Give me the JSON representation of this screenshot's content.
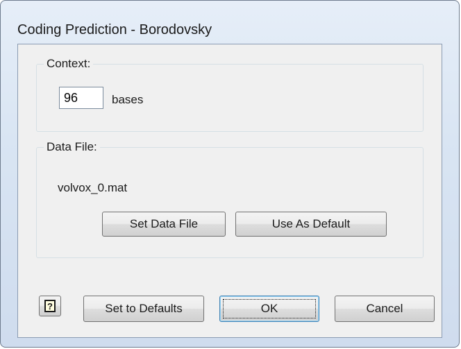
{
  "window": {
    "title": "Coding Prediction - Borodovsky"
  },
  "context": {
    "group_label": "Context:",
    "value": "96",
    "unit": "bases"
  },
  "data_file": {
    "group_label": "Data File:",
    "file_name": "volvox_0.mat",
    "set_button": "Set Data File",
    "default_button": "Use As Default"
  },
  "footer": {
    "help_icon": "question-mark-icon",
    "help_glyph": "?",
    "defaults_button": "Set to Defaults",
    "ok_button": "OK",
    "cancel_button": "Cancel"
  },
  "colors": {
    "frame": "#d9e5f3",
    "client": "#f0f0f0",
    "default_button_border": "#3c7fb1"
  }
}
